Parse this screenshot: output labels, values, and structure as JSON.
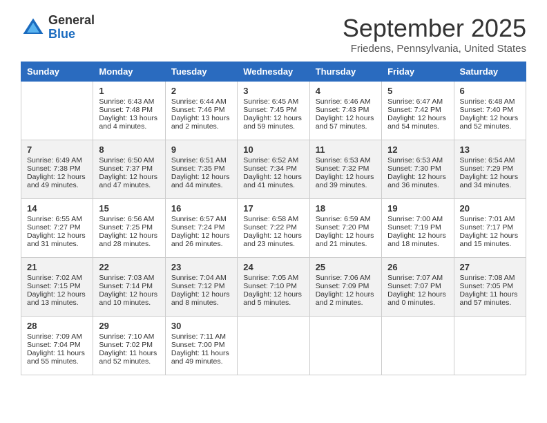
{
  "logo": {
    "general": "General",
    "blue": "Blue"
  },
  "title": "September 2025",
  "location": "Friedens, Pennsylvania, United States",
  "days_of_week": [
    "Sunday",
    "Monday",
    "Tuesday",
    "Wednesday",
    "Thursday",
    "Friday",
    "Saturday"
  ],
  "weeks": [
    [
      {
        "day": "",
        "sunrise": "",
        "sunset": "",
        "daylight": ""
      },
      {
        "day": "1",
        "sunrise": "Sunrise: 6:43 AM",
        "sunset": "Sunset: 7:48 PM",
        "daylight": "Daylight: 13 hours and 4 minutes."
      },
      {
        "day": "2",
        "sunrise": "Sunrise: 6:44 AM",
        "sunset": "Sunset: 7:46 PM",
        "daylight": "Daylight: 13 hours and 2 minutes."
      },
      {
        "day": "3",
        "sunrise": "Sunrise: 6:45 AM",
        "sunset": "Sunset: 7:45 PM",
        "daylight": "Daylight: 12 hours and 59 minutes."
      },
      {
        "day": "4",
        "sunrise": "Sunrise: 6:46 AM",
        "sunset": "Sunset: 7:43 PM",
        "daylight": "Daylight: 12 hours and 57 minutes."
      },
      {
        "day": "5",
        "sunrise": "Sunrise: 6:47 AM",
        "sunset": "Sunset: 7:42 PM",
        "daylight": "Daylight: 12 hours and 54 minutes."
      },
      {
        "day": "6",
        "sunrise": "Sunrise: 6:48 AM",
        "sunset": "Sunset: 7:40 PM",
        "daylight": "Daylight: 12 hours and 52 minutes."
      }
    ],
    [
      {
        "day": "7",
        "sunrise": "Sunrise: 6:49 AM",
        "sunset": "Sunset: 7:38 PM",
        "daylight": "Daylight: 12 hours and 49 minutes."
      },
      {
        "day": "8",
        "sunrise": "Sunrise: 6:50 AM",
        "sunset": "Sunset: 7:37 PM",
        "daylight": "Daylight: 12 hours and 47 minutes."
      },
      {
        "day": "9",
        "sunrise": "Sunrise: 6:51 AM",
        "sunset": "Sunset: 7:35 PM",
        "daylight": "Daylight: 12 hours and 44 minutes."
      },
      {
        "day": "10",
        "sunrise": "Sunrise: 6:52 AM",
        "sunset": "Sunset: 7:34 PM",
        "daylight": "Daylight: 12 hours and 41 minutes."
      },
      {
        "day": "11",
        "sunrise": "Sunrise: 6:53 AM",
        "sunset": "Sunset: 7:32 PM",
        "daylight": "Daylight: 12 hours and 39 minutes."
      },
      {
        "day": "12",
        "sunrise": "Sunrise: 6:53 AM",
        "sunset": "Sunset: 7:30 PM",
        "daylight": "Daylight: 12 hours and 36 minutes."
      },
      {
        "day": "13",
        "sunrise": "Sunrise: 6:54 AM",
        "sunset": "Sunset: 7:29 PM",
        "daylight": "Daylight: 12 hours and 34 minutes."
      }
    ],
    [
      {
        "day": "14",
        "sunrise": "Sunrise: 6:55 AM",
        "sunset": "Sunset: 7:27 PM",
        "daylight": "Daylight: 12 hours and 31 minutes."
      },
      {
        "day": "15",
        "sunrise": "Sunrise: 6:56 AM",
        "sunset": "Sunset: 7:25 PM",
        "daylight": "Daylight: 12 hours and 28 minutes."
      },
      {
        "day": "16",
        "sunrise": "Sunrise: 6:57 AM",
        "sunset": "Sunset: 7:24 PM",
        "daylight": "Daylight: 12 hours and 26 minutes."
      },
      {
        "day": "17",
        "sunrise": "Sunrise: 6:58 AM",
        "sunset": "Sunset: 7:22 PM",
        "daylight": "Daylight: 12 hours and 23 minutes."
      },
      {
        "day": "18",
        "sunrise": "Sunrise: 6:59 AM",
        "sunset": "Sunset: 7:20 PM",
        "daylight": "Daylight: 12 hours and 21 minutes."
      },
      {
        "day": "19",
        "sunrise": "Sunrise: 7:00 AM",
        "sunset": "Sunset: 7:19 PM",
        "daylight": "Daylight: 12 hours and 18 minutes."
      },
      {
        "day": "20",
        "sunrise": "Sunrise: 7:01 AM",
        "sunset": "Sunset: 7:17 PM",
        "daylight": "Daylight: 12 hours and 15 minutes."
      }
    ],
    [
      {
        "day": "21",
        "sunrise": "Sunrise: 7:02 AM",
        "sunset": "Sunset: 7:15 PM",
        "daylight": "Daylight: 12 hours and 13 minutes."
      },
      {
        "day": "22",
        "sunrise": "Sunrise: 7:03 AM",
        "sunset": "Sunset: 7:14 PM",
        "daylight": "Daylight: 12 hours and 10 minutes."
      },
      {
        "day": "23",
        "sunrise": "Sunrise: 7:04 AM",
        "sunset": "Sunset: 7:12 PM",
        "daylight": "Daylight: 12 hours and 8 minutes."
      },
      {
        "day": "24",
        "sunrise": "Sunrise: 7:05 AM",
        "sunset": "Sunset: 7:10 PM",
        "daylight": "Daylight: 12 hours and 5 minutes."
      },
      {
        "day": "25",
        "sunrise": "Sunrise: 7:06 AM",
        "sunset": "Sunset: 7:09 PM",
        "daylight": "Daylight: 12 hours and 2 minutes."
      },
      {
        "day": "26",
        "sunrise": "Sunrise: 7:07 AM",
        "sunset": "Sunset: 7:07 PM",
        "daylight": "Daylight: 12 hours and 0 minutes."
      },
      {
        "day": "27",
        "sunrise": "Sunrise: 7:08 AM",
        "sunset": "Sunset: 7:05 PM",
        "daylight": "Daylight: 11 hours and 57 minutes."
      }
    ],
    [
      {
        "day": "28",
        "sunrise": "Sunrise: 7:09 AM",
        "sunset": "Sunset: 7:04 PM",
        "daylight": "Daylight: 11 hours and 55 minutes."
      },
      {
        "day": "29",
        "sunrise": "Sunrise: 7:10 AM",
        "sunset": "Sunset: 7:02 PM",
        "daylight": "Daylight: 11 hours and 52 minutes."
      },
      {
        "day": "30",
        "sunrise": "Sunrise: 7:11 AM",
        "sunset": "Sunset: 7:00 PM",
        "daylight": "Daylight: 11 hours and 49 minutes."
      },
      {
        "day": "",
        "sunrise": "",
        "sunset": "",
        "daylight": ""
      },
      {
        "day": "",
        "sunrise": "",
        "sunset": "",
        "daylight": ""
      },
      {
        "day": "",
        "sunrise": "",
        "sunset": "",
        "daylight": ""
      },
      {
        "day": "",
        "sunrise": "",
        "sunset": "",
        "daylight": ""
      }
    ]
  ]
}
